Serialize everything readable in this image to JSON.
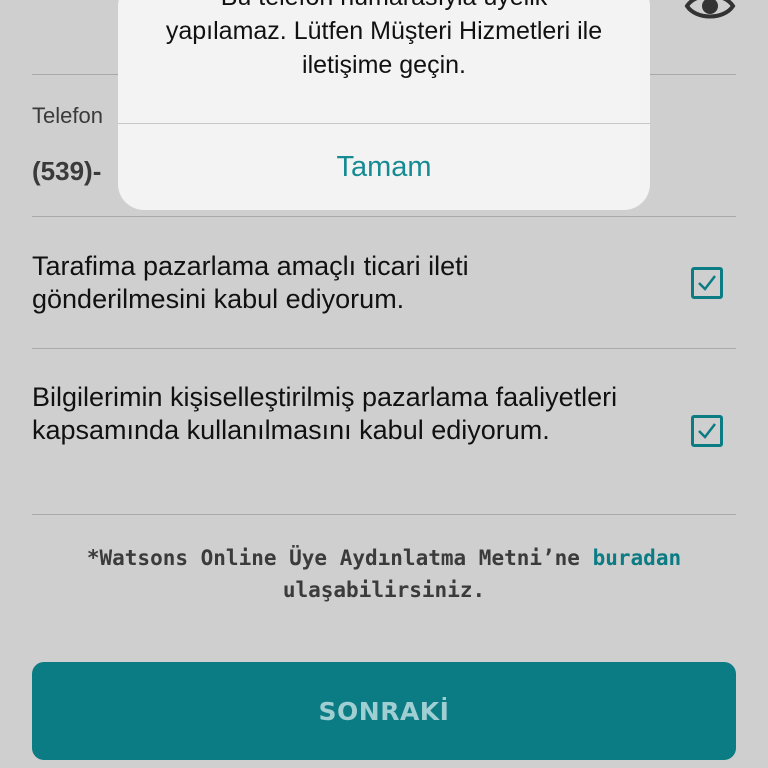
{
  "form": {
    "phone_label": "Telefon",
    "phone_value": "(539)-"
  },
  "consents": [
    {
      "text": "Tarafima pazarlama amaçlı ticari ileti gönderilmesini kabul ediyorum.",
      "checked": true
    },
    {
      "text": "Bilgilerimin kişiselleştirilmiş pazarlama faaliyetleri kapsamında kullanılmasını kabul ediyorum.",
      "checked": true
    }
  ],
  "note": {
    "prefix": "*Watsons Online Üye Aydınlatma Metni’ne",
    "link": "buradan",
    "suffix": "ulaşabilirsiniz."
  },
  "next_button": "SONRAKİ",
  "alert": {
    "message_lines": [
      "Bu telefon numarasıyla üyelik",
      "yapılamaz. Lütfen Müşteri Hizmetleri ile",
      "iletişime geçin."
    ],
    "ok_button": "Tamam"
  },
  "colors": {
    "accent": "#0b7b84",
    "background": "#cfcfcf",
    "alert_bg": "#f3f3f3"
  },
  "icons": {
    "password_toggle": "eye-icon",
    "check": "checkmark-icon"
  }
}
